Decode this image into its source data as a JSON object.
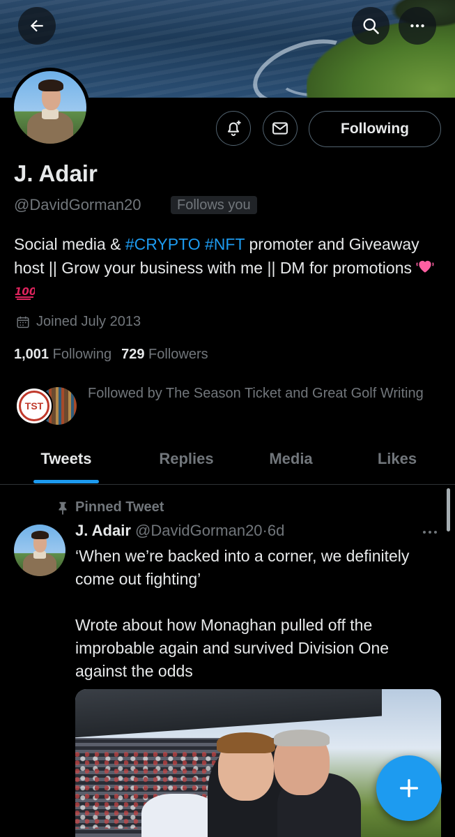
{
  "profile": {
    "display_name": "J. Adair",
    "handle": "@DavidGorman20",
    "follows_you": "Follows you",
    "bio_part1": "Social media & ",
    "bio_tag1": "#CRYPTO",
    "bio_tag2": "#NFT",
    "bio_part2": " promoter and Giveaway host || Grow your business with me || DM for promotions ",
    "bio_emojis": [
      "heart-emoji",
      "hundred-points-emoji"
    ],
    "joined": "Joined July 2013",
    "following_count": "1,001",
    "following_label": "Following",
    "followers_count": "729",
    "followers_label": "Followers",
    "followed_by": "Followed by The Season Ticket and Great Golf Writing",
    "followed_by_badge": "TST"
  },
  "actions": {
    "following_label": "Following"
  },
  "icons": {
    "back": "back-arrow-icon",
    "search": "search-icon",
    "more": "more-icon",
    "notify": "bell-plus-icon",
    "message": "envelope-icon",
    "calendar": "calendar-icon",
    "pin": "pin-icon",
    "compose": "plus-icon"
  },
  "tabs": [
    {
      "label": "Tweets",
      "active": true
    },
    {
      "label": "Replies",
      "active": false
    },
    {
      "label": "Media",
      "active": false
    },
    {
      "label": "Likes",
      "active": false
    }
  ],
  "tweet": {
    "pinned_label": "Pinned Tweet",
    "author_name": "J. Adair",
    "author_handle": "@DavidGorman20",
    "separator": "·",
    "age": "6d",
    "text_paragraph_1": "‘When we’re backed into a corner, we definitely come out fighting’",
    "text_paragraph_2": "Wrote about how Monaghan pulled off the improbable again and survived Division One against the odds"
  },
  "colors": {
    "background": "#000000",
    "text_primary": "#e7e9ea",
    "text_secondary": "#71767b",
    "accent": "#1d9bf0",
    "border": "#2f3336"
  }
}
